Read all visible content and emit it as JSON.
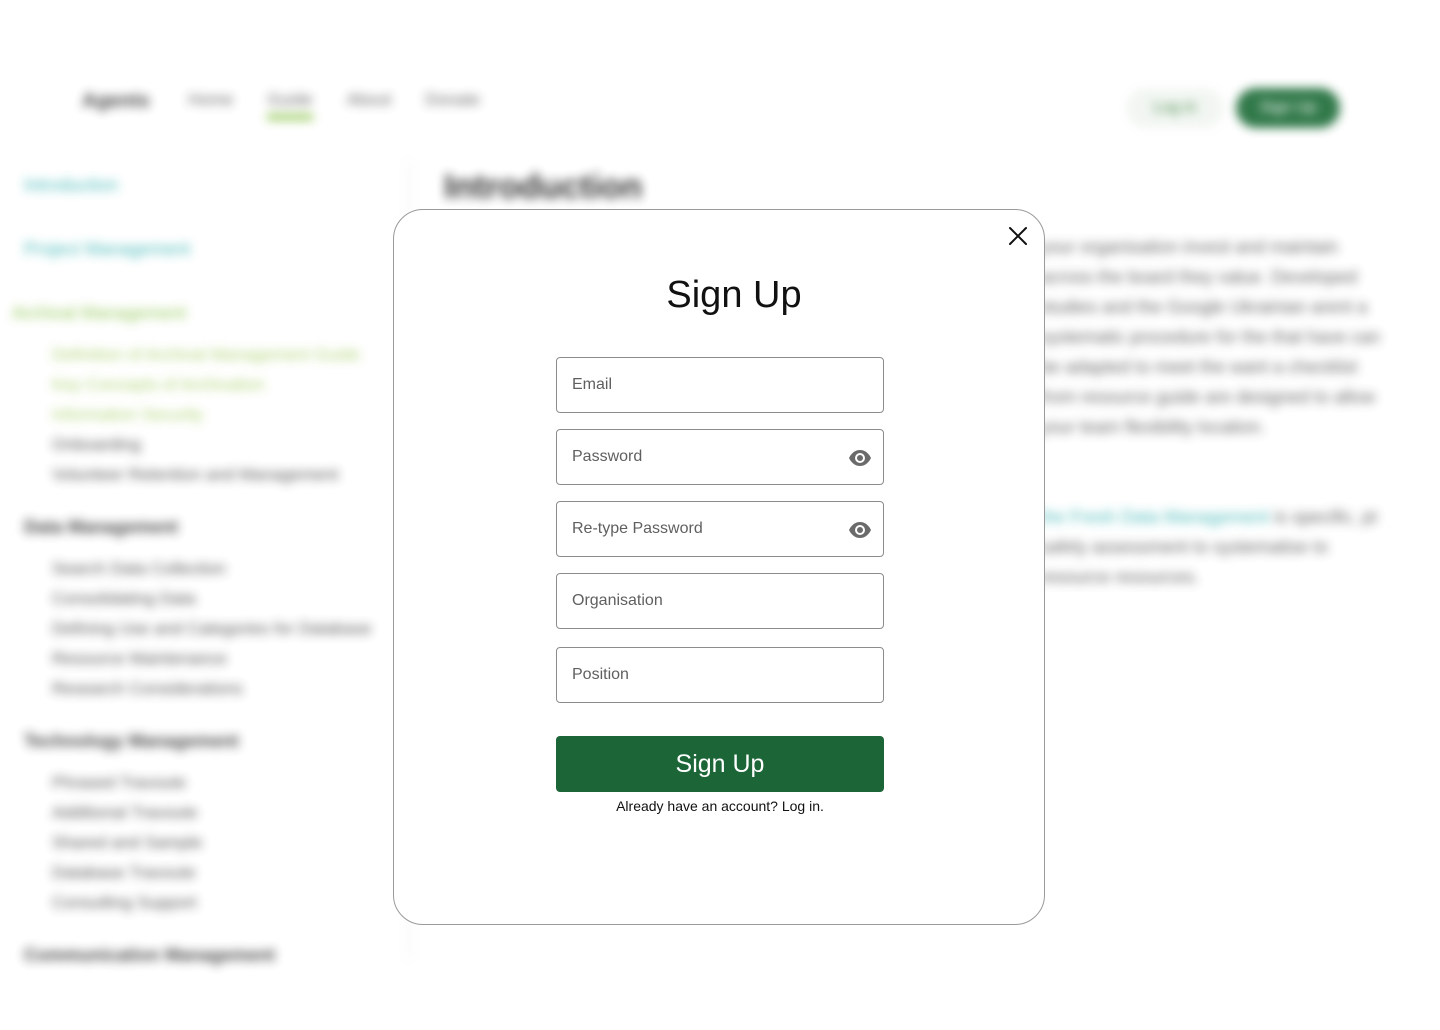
{
  "background": {
    "brand": "Agents",
    "nav": [
      "Home",
      "Guide",
      "About",
      "Donate"
    ],
    "login_label": "Log in",
    "signup_label": "Sign Up",
    "page_title": "Introduction",
    "sidebar": [
      {
        "title": "Introduction",
        "items": []
      },
      {
        "title": "Project Management",
        "items": []
      },
      {
        "title": "Archival Management",
        "items": [
          "Definition of Archival Management Guide",
          "Key Concepts of Archivation",
          "Information Security",
          "Onboarding",
          "Volunteer Retention and Management"
        ]
      },
      {
        "title": "Data Management",
        "items": [
          "Search Data Collection",
          "Consolidating Data",
          "Defining Use and Categories for Database",
          "Resource Maintenance",
          "Research Considerations"
        ]
      },
      {
        "title": "Technology Management",
        "items": [
          "Phrased Travoute",
          "Additional Travoute",
          "Shared and Sample",
          "Database Travoute",
          "Consulting Support"
        ]
      },
      {
        "title": "Communication Management",
        "items": []
      }
    ],
    "paragraph1": "your organisation invest and maintain across the board they value. Developed studies and the Google Ukrainian arent a systematic procedure for the that have can be adapted to meet the want a checklist from resource guide are designed to allow your team flexibility location.",
    "paragraph2_link": "the Fresh Data Management",
    "paragraph2": "is specific, pt safely assessment to systematise to resource resources."
  },
  "modal": {
    "title": "Sign Up",
    "fields": {
      "email": {
        "placeholder": "Email",
        "value": ""
      },
      "password": {
        "placeholder": "Password",
        "value": ""
      },
      "retype": {
        "placeholder": "Re-type Password",
        "value": ""
      },
      "organisation": {
        "placeholder": "Organisation",
        "value": ""
      },
      "position": {
        "placeholder": "Position",
        "value": ""
      }
    },
    "submit_label": "Sign Up",
    "login_prompt": "Already have an account?",
    "login_link": "Log in."
  },
  "colors": {
    "primary_green": "#1b6537",
    "accent_teal": "#38b2b2",
    "accent_lime": "#8bc34a"
  },
  "icons": {
    "close": "close-icon",
    "visibility": "eye-icon"
  }
}
